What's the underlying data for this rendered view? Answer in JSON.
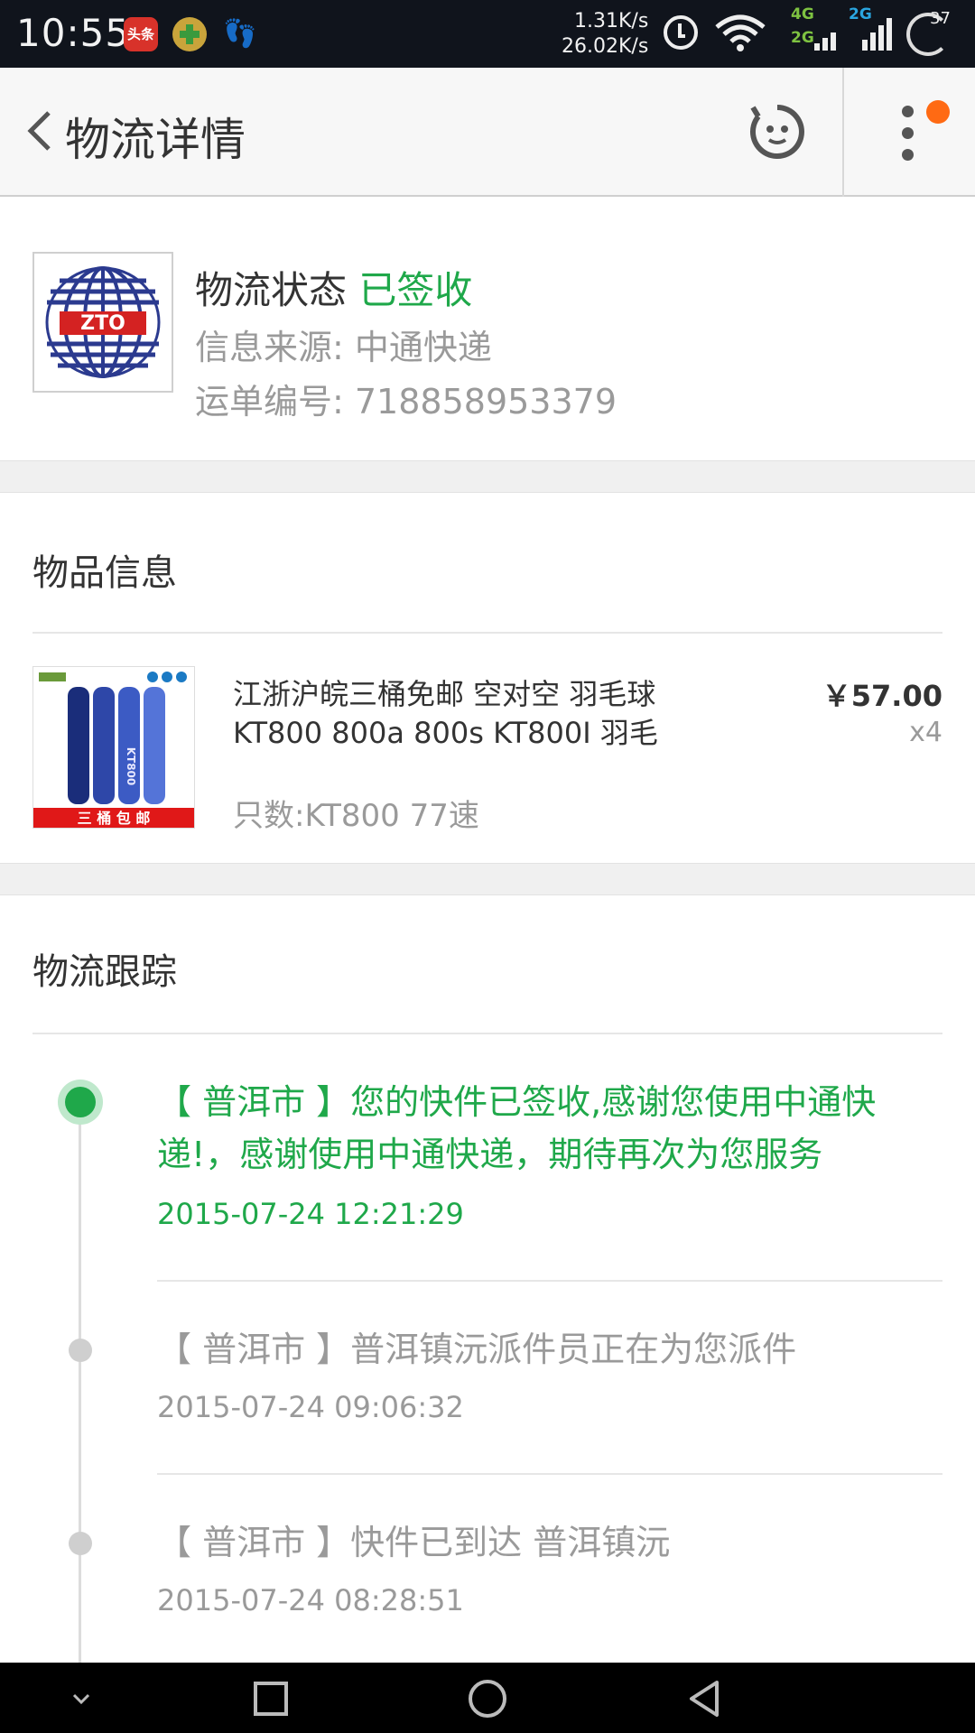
{
  "statusbar": {
    "time": "10:55",
    "toutiao_label": "头条",
    "speed_up": "1.31K/s",
    "speed_down": "26.02K/s",
    "net_4g": "4G",
    "net_2g_top": "2G",
    "net_2g_bottom": "2G",
    "battery": "37",
    "accent_4g": "#7ec241",
    "accent_2g": "#2aa6e0"
  },
  "header": {
    "title": "物流详情"
  },
  "logistics": {
    "logo_text": "ZTO",
    "status_label": "物流状态",
    "status_value": "已签收",
    "source": "信息来源: 中通快递",
    "waybill": "运单编号: 718858953379"
  },
  "item_section": {
    "title": "物品信息",
    "product": {
      "name": "江浙沪皖三桶免邮 空对空 羽毛球KT800 800a 800s KT800I 羽毛",
      "price": "￥57.00",
      "quantity": "x4",
      "spec": "只数:KT800 77速",
      "image_banner": "三 桶 包 邮",
      "image_label": "KT800"
    }
  },
  "tracking_section": {
    "title": "物流跟踪",
    "events": [
      {
        "text": "【 普洱市 】您的快件已签收,感谢您使用中通快递!，感谢使用中通快递，期待再次为您服务",
        "time": "2015-07-24 12:21:29"
      },
      {
        "text": "【 普洱市 】普洱镇沅派件员正在为您派件",
        "time": "2015-07-24 09:06:32"
      },
      {
        "text": "【 普洱市 】快件已到达 普洱镇沅",
        "time": "2015-07-24 08:28:51"
      }
    ]
  },
  "colors": {
    "accent_green": "#1fa84a",
    "notify_orange": "#ff6a13"
  },
  "icons": [
    "back-icon",
    "bot-icon",
    "more-icon",
    "alarm-icon",
    "wifi-icon",
    "signal-icon",
    "battery-icon",
    "nav-down-icon",
    "nav-home-icon",
    "nav-recent-icon",
    "nav-back-icon"
  ]
}
